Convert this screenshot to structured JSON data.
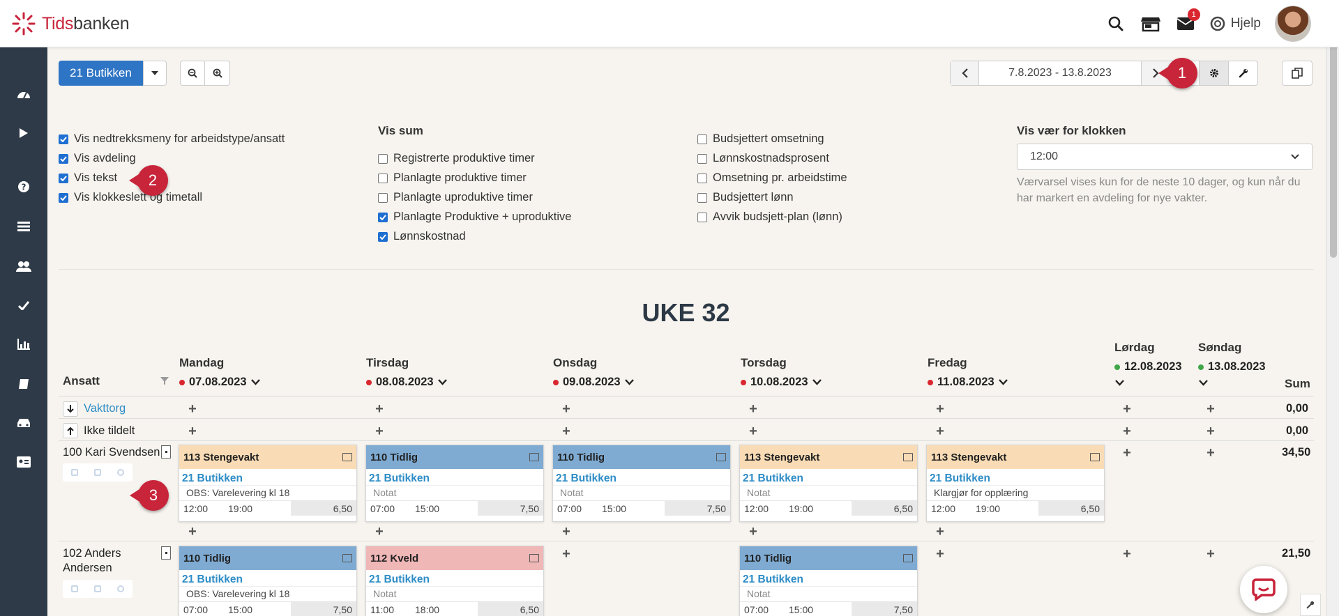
{
  "app": {
    "brand_a": "Tids",
    "brand_b": "banken"
  },
  "header": {
    "help_label": "Hjelp",
    "mail_badge": "1"
  },
  "toolbar": {
    "department": "21 Butikken",
    "date_range": "7.8.2023 - 13.8.2023"
  },
  "callouts": [
    "1",
    "2",
    "3"
  ],
  "settings": {
    "col1": [
      {
        "label": "Vis nedtrekksmeny for arbeidstype/ansatt",
        "checked": true
      },
      {
        "label": "Vis avdeling",
        "checked": true
      },
      {
        "label": "Vis tekst",
        "checked": true
      },
      {
        "label": "Vis klokkeslett og timetall",
        "checked": true
      }
    ],
    "col2_title": "Vis sum",
    "col2": [
      {
        "label": "Registrerte produktive timer",
        "checked": false
      },
      {
        "label": "Planlagte produktive timer",
        "checked": false
      },
      {
        "label": "Planlagte uproduktive timer",
        "checked": false
      },
      {
        "label": "Planlagte Produktive + uproduktive",
        "checked": true
      },
      {
        "label": "Lønnskostnad",
        "checked": true
      }
    ],
    "col3": [
      {
        "label": "Budsjettert omsetning",
        "checked": false
      },
      {
        "label": "Lønnskostnadsprosent",
        "checked": false
      },
      {
        "label": "Omsetning pr. arbeidstime",
        "checked": false
      },
      {
        "label": "Budsjettert lønn",
        "checked": false
      },
      {
        "label": "Avvik budsjett-plan (lønn)",
        "checked": false
      }
    ],
    "weather_title": "Vis vær for klokken",
    "weather_value": "12:00",
    "weather_note": "Værvarsel vises kun for de neste 10 dager, og kun når du har markert en avdeling for nye vakter."
  },
  "schedule": {
    "week_title": "UKE 32",
    "employee_header": "Ansatt",
    "sum_header": "Sum",
    "days": [
      {
        "name": "Mandag",
        "date": "07.08.2023",
        "dot": "#d9262f"
      },
      {
        "name": "Tirsdag",
        "date": "08.08.2023",
        "dot": "#d9262f"
      },
      {
        "name": "Onsdag",
        "date": "09.08.2023",
        "dot": "#d9262f"
      },
      {
        "name": "Torsdag",
        "date": "10.08.2023",
        "dot": "#d9262f"
      },
      {
        "name": "Fredag",
        "date": "11.08.2023",
        "dot": "#d9262f"
      },
      {
        "name": "Lørdag",
        "date": "12.08.2023",
        "dot": "#3fa64a"
      },
      {
        "name": "Søndag",
        "date": "13.08.2023",
        "dot": "#3fa64a"
      }
    ],
    "special_rows": [
      {
        "label": "Vakttorg",
        "sum": "0,00"
      },
      {
        "label": "Ikke tildelt",
        "sum": "0,00"
      }
    ],
    "employees": [
      {
        "name": "100 Kari Svendsen",
        "sum": "34,50",
        "shifts": [
          {
            "title": "113 Stengevakt",
            "color": "#f9dcb5",
            "dept": "21 Butikken",
            "text": "OBS: Varelevering kl 18",
            "muted": false,
            "start": "12:00",
            "end": "19:00",
            "hours": "6,50"
          },
          {
            "title": "110 Tidlig",
            "color": "#7fabd3",
            "dept": "21 Butikken",
            "text": "Notat",
            "muted": true,
            "start": "07:00",
            "end": "15:00",
            "hours": "7,50"
          },
          {
            "title": "110 Tidlig",
            "color": "#7fabd3",
            "dept": "21 Butikken",
            "text": "Notat",
            "muted": true,
            "start": "07:00",
            "end": "15:00",
            "hours": "7,50"
          },
          {
            "title": "113 Stengevakt",
            "color": "#f9dcb5",
            "dept": "21 Butikken",
            "text": "Notat",
            "muted": true,
            "start": "12:00",
            "end": "19:00",
            "hours": "6,50"
          },
          {
            "title": "113 Stengevakt",
            "color": "#f9dcb5",
            "dept": "21 Butikken",
            "text": "Klargjør for opplæring",
            "muted": false,
            "start": "12:00",
            "end": "19:00",
            "hours": "6,50"
          }
        ]
      },
      {
        "name_line1": "102 Anders",
        "name_line2": "Andersen",
        "sum": "21,50",
        "shifts": [
          {
            "title": "110 Tidlig",
            "color": "#7fabd3",
            "dept": "21 Butikken",
            "text": "OBS: Varelevering kl 18",
            "muted": false,
            "start": "07:00",
            "end": "15:00",
            "hours": "7,50"
          },
          {
            "title": "112 Kveld",
            "color": "#f0b7b7",
            "dept": "21 Butikken",
            "text": "Notat",
            "muted": true,
            "start": "11:00",
            "end": "18:00",
            "hours": "6,50"
          },
          {
            "title": "110 Tidlig",
            "color": "#7fabd3",
            "dept": "21 Butikken",
            "text": "Notat",
            "muted": true,
            "start": "07:00",
            "end": "15:00",
            "hours": "7,50"
          }
        ]
      }
    ]
  }
}
